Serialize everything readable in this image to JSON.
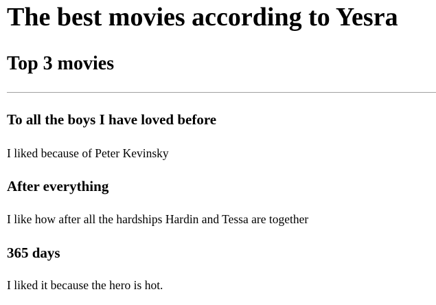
{
  "page": {
    "title": "The best movies according to Yesra",
    "subtitle": "Top 3 movies"
  },
  "movies": [
    {
      "title": "To all the boys I have loved before",
      "comment": "I liked because of Peter Kevinsky"
    },
    {
      "title": "After everything",
      "comment": "I like how after all the hardships Hardin and Tessa are together"
    },
    {
      "title": "365 days",
      "comment": "I liked it because the hero is hot."
    }
  ]
}
